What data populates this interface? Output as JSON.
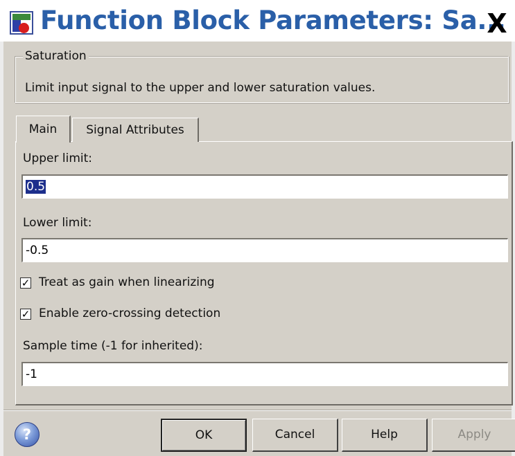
{
  "window": {
    "title": "Function Block Parameters: Sa...",
    "close_label": "X"
  },
  "block": {
    "group_title": "Saturation",
    "description": "Limit input signal to the upper and lower saturation values."
  },
  "tabs": [
    {
      "label": "Main",
      "active": true
    },
    {
      "label": "Signal Attributes",
      "active": false
    }
  ],
  "params": {
    "upper_limit": {
      "label": "Upper limit:",
      "value": "0.5"
    },
    "lower_limit": {
      "label": "Lower limit:",
      "value": "-0.5"
    },
    "treat_as_gain": {
      "label": "Treat as gain when linearizing",
      "checked": true,
      "mark": "✓"
    },
    "zero_crossing": {
      "label": "Enable zero-crossing detection",
      "checked": true,
      "mark": "✓"
    },
    "sample_time": {
      "label": "Sample time (-1 for inherited):",
      "value": "-1"
    }
  },
  "buttons": {
    "help_icon": "?",
    "ok": "OK",
    "cancel": "Cancel",
    "help": "Help",
    "apply": "Apply"
  },
  "colors": {
    "title_text": "#2a5fa8",
    "dialog_bg": "#d4d0c8",
    "selection": "#1d2f8c"
  }
}
